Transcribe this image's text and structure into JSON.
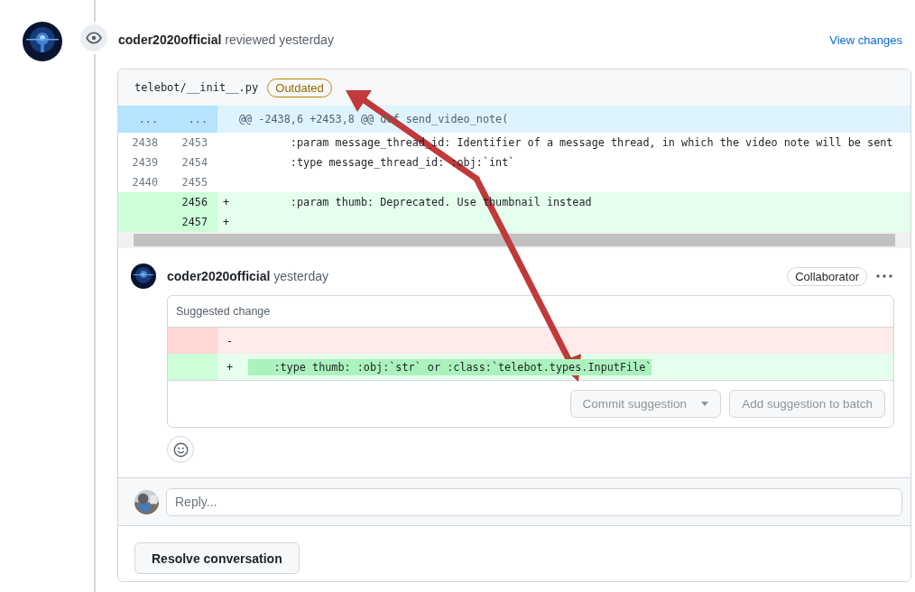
{
  "review": {
    "author": "coder2020official",
    "action": "reviewed yesterday",
    "link": "View changes"
  },
  "file": {
    "path": "telebot/__init__.py",
    "badge": "Outdated"
  },
  "hunk": {
    "old": "...",
    "new": "...",
    "header": "@@ -2438,6 +2453,8 @@ def send_video_note("
  },
  "lines": [
    {
      "kind": "context",
      "old": "2438",
      "new": "2453",
      "code": "        :param message_thread_id: Identifier of a message thread, in which the video note will be sent"
    },
    {
      "kind": "context",
      "old": "2439",
      "new": "2454",
      "code": "        :type message_thread_id: :obj:`int`"
    },
    {
      "kind": "context",
      "old": "2440",
      "new": "2455"
    },
    {
      "kind": "added",
      "new": "2456",
      "marker": "+",
      "code": "        :param thumb: Deprecated. Use thumbnail instead"
    },
    {
      "kind": "added",
      "new": "2457",
      "marker": "+"
    }
  ],
  "comment": {
    "author": "coder2020official",
    "time": "yesterday",
    "role": "Collaborator",
    "suggestion": {
      "title": "Suggested change",
      "lines": [
        {
          "kind": "deleted",
          "marker": "-"
        },
        {
          "kind": "added",
          "marker": "+",
          "code": "    :type thumb: :obj:`str` or :class:`telebot.types.InputFile`"
        }
      ],
      "buttons": [
        {
          "label": "Commit suggestion",
          "dropdown": true,
          "disabled": true
        },
        {
          "label": "Add suggestion to batch",
          "dropdown": false,
          "disabled": true
        }
      ]
    }
  },
  "reply": {
    "placeholder": "Reply..."
  },
  "resolve_button": "Resolve conversation"
}
